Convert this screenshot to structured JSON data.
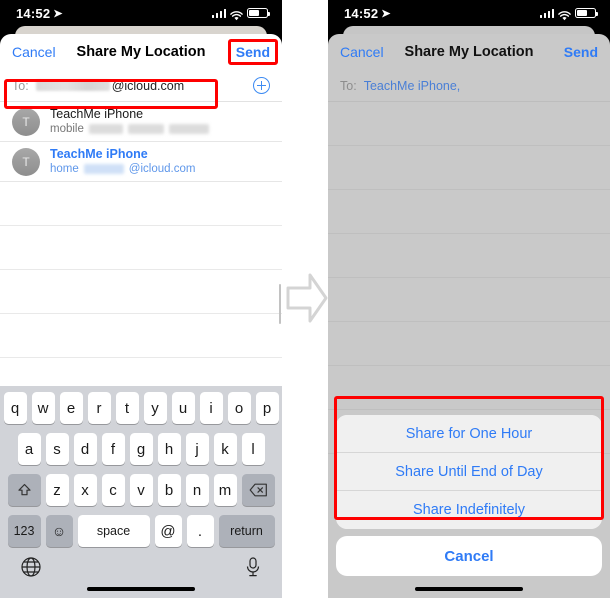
{
  "status_bar": {
    "time": "14:52",
    "location_icon": "location-arrow-icon",
    "signal_icon": "cellular-bars-icon",
    "wifi_icon": "wifi-icon",
    "battery_icon": "battery-icon"
  },
  "left_phone": {
    "navbar": {
      "cancel_label": "Cancel",
      "title": "Share My Location",
      "send_label": "Send"
    },
    "to_field": {
      "label": "To:",
      "redacted_value": "",
      "value_suffix": "@icloud.com",
      "add_contact_icon": "add-contact-plus-icon"
    },
    "contacts": [
      {
        "avatar_initial": "T",
        "name": "TeachMe iPhone",
        "detail_label": "mobile",
        "detail_value": "",
        "selected": false
      },
      {
        "avatar_initial": "T",
        "name": "TeachMe iPhone",
        "detail_label": "home",
        "detail_value": "@icloud.com",
        "selected": true
      }
    ],
    "keyboard": {
      "row1": [
        "q",
        "w",
        "e",
        "r",
        "t",
        "y",
        "u",
        "i",
        "o",
        "p"
      ],
      "row2": [
        "a",
        "s",
        "d",
        "f",
        "g",
        "h",
        "j",
        "k",
        "l"
      ],
      "row3_letters": [
        "z",
        "x",
        "c",
        "v",
        "b",
        "n",
        "m"
      ],
      "shift_icon": "shift-arrow-icon",
      "delete_icon": "backspace-delete-icon",
      "numbers_label": "123",
      "emoji_icon": "emoji-smiley-icon",
      "space_label": "space",
      "at_label": "@",
      "dot_label": ".",
      "return_label": "return",
      "globe_icon": "globe-keyboard-icon",
      "dictation_icon": "microphone-icon"
    }
  },
  "right_phone": {
    "navbar": {
      "cancel_label": "Cancel",
      "title": "Share My Location",
      "send_label": "Send"
    },
    "to_field": {
      "label": "To:",
      "value": "TeachMe iPhone,"
    },
    "action_sheet": {
      "options": [
        "Share for One Hour",
        "Share Until End of Day",
        "Share Indefinitely"
      ],
      "cancel_label": "Cancel"
    }
  },
  "annotations": {
    "arrow_icon": "right-arrow-step-icon",
    "highlight_color": "#fe0000"
  },
  "colors": {
    "accent_blue": "#2f7bf6",
    "status_bar_bg": "#000000",
    "sheet_bg": "#ffffff",
    "dimmed_sheet_bg": "#c9c9c9",
    "keyboard_bg": "#d1d3d8"
  }
}
